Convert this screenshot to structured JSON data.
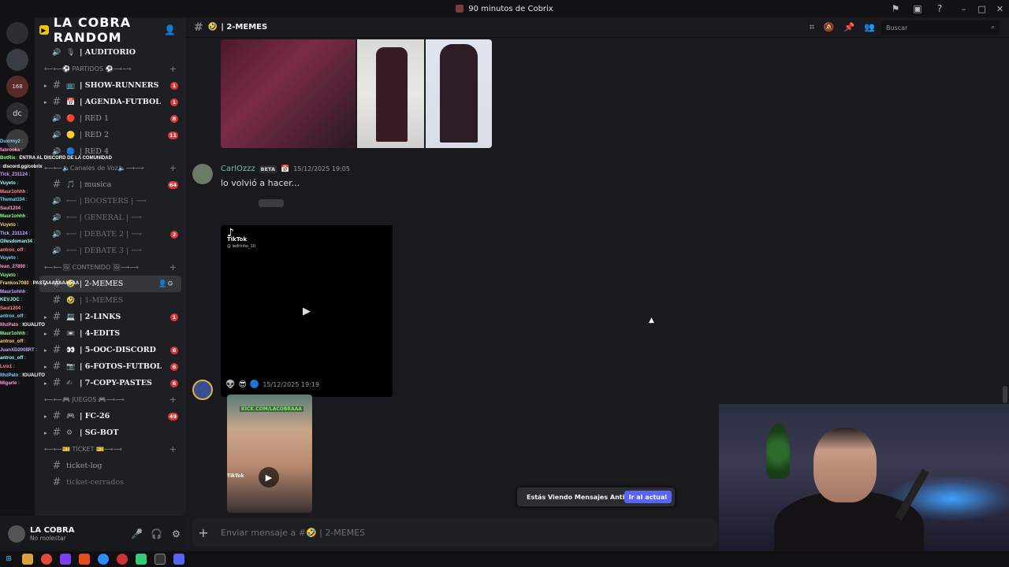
{
  "window": {
    "title": "90 minutos de Cobrix"
  },
  "server": {
    "name": "LA COBRA RANDOM"
  },
  "rail": {
    "items": [
      "",
      "168",
      "dc",
      "",
      "",
      ""
    ]
  },
  "chat_overlay": [
    {
      "u": "Duxrmy2",
      "t": ""
    },
    {
      "u": "fabrooks",
      "t": ""
    },
    {
      "u": "BotRix",
      "t": "ENTRA AL DISCORD DE LA COMUNIDAD"
    },
    {
      "u": "",
      "t": "discord.gg/cobrix"
    },
    {
      "u": "Tick_231124",
      "t": ""
    },
    {
      "u": "Vuyeto",
      "t": ""
    },
    {
      "u": "Maur1ohhh",
      "t": ""
    },
    {
      "u": "Themat104",
      "t": ""
    },
    {
      "u": "Saul1204",
      "t": ""
    },
    {
      "u": "Maur1ohhh",
      "t": ""
    },
    {
      "u": "Vuyeto",
      "t": ""
    },
    {
      "u": "Tick_231124",
      "t": ""
    },
    {
      "u": "Ollesdoman34",
      "t": ""
    },
    {
      "u": "antrox_off",
      "t": ""
    },
    {
      "u": "Vuyeto",
      "t": ""
    },
    {
      "u": "lean_27890",
      "t": ""
    },
    {
      "u": "Vuyeto",
      "t": ""
    },
    {
      "u": "Frankos7080",
      "t": "PASTAAAAAAAAAA"
    },
    {
      "u": "Maur1ohhh",
      "t": ""
    },
    {
      "u": "KEVJOC",
      "t": ""
    },
    {
      "u": "Saul1204",
      "t": ""
    },
    {
      "u": "antrox_off",
      "t": ""
    },
    {
      "u": "IthzPato",
      "t": "IGUALITO"
    },
    {
      "u": "Maur1ohhh",
      "t": ""
    },
    {
      "u": "antrox_off",
      "t": ""
    },
    {
      "u": "JuanXD2008RT",
      "t": ""
    },
    {
      "u": "antrox_off",
      "t": ""
    },
    {
      "u": "Lvix1",
      "t": ""
    },
    {
      "u": "IthzPato",
      "t": "IGUALITO"
    },
    {
      "u": "Migarte",
      "t": ""
    }
  ],
  "channels": [
    {
      "type": "ch",
      "icon": "speaker",
      "emo": "🎙",
      "label": "| AUDITORIO",
      "style": "bold-voice"
    },
    {
      "type": "cat",
      "label": "⟵⟵⚽ PARTIDOS ⚽⟶⟶"
    },
    {
      "type": "ch",
      "emo": "📺",
      "label": "| SHOW-RUNNERS",
      "style": "bold",
      "badge": "1"
    },
    {
      "type": "ch",
      "emo": "📅",
      "label": "| AGENDA-FUTBOL",
      "style": "bold",
      "badge": "1"
    },
    {
      "type": "ch",
      "icon": "speaker",
      "emo": "🔴",
      "label": "| RED 1",
      "style": "",
      "badge": "8"
    },
    {
      "type": "ch",
      "icon": "speaker",
      "emo": "🟡",
      "label": "| RED 2",
      "style": "",
      "badge": "11"
    },
    {
      "type": "ch",
      "icon": "speaker",
      "emo": "🔵",
      "label": "| RED 4",
      "style": ""
    },
    {
      "type": "cat",
      "label": "⟵⟵🔈Canales de Voz🔈⟶⟶"
    },
    {
      "type": "ch",
      "emo": "🎵",
      "label": "| musica",
      "style": "plain",
      "badge": "64"
    },
    {
      "type": "ch",
      "icon": "speaker",
      "emo": "",
      "label": "⟵ | BOOSTERS | ⟶",
      "style": "dim"
    },
    {
      "type": "ch",
      "icon": "speaker",
      "emo": "",
      "label": "⟵ | GENERAL | ⟶",
      "style": "dim"
    },
    {
      "type": "ch",
      "icon": "speaker",
      "emo": "",
      "label": "⟵ | DEBATE 2 | ⟶",
      "style": "dim",
      "badge": "2"
    },
    {
      "type": "ch",
      "icon": "speaker",
      "emo": "",
      "label": "⟵ | DEBATE 3 | ⟶",
      "style": "dim"
    },
    {
      "type": "cat",
      "label": "⟵⟵🖼 CONTENIDO 🖼⟶⟶"
    },
    {
      "type": "ch",
      "emo": "🤣",
      "label": "| 2-MEMES",
      "style": "active"
    },
    {
      "type": "ch",
      "emo": "🤣",
      "label": "| 1-MEMES",
      "style": "dim"
    },
    {
      "type": "ch",
      "emo": "💻",
      "label": "| 2-LINKS",
      "style": "bold",
      "badge": "1"
    },
    {
      "type": "ch",
      "emo": "📼",
      "label": "| 4-EDITS",
      "style": "bold"
    },
    {
      "type": "ch",
      "emo": "👀",
      "label": "| 5-OOC-DISCORD",
      "style": "bold",
      "badge": "6"
    },
    {
      "type": "ch",
      "emo": "📷",
      "label": "| 6-FOTOS-FUTBOL",
      "style": "bold",
      "badge": "6"
    },
    {
      "type": "ch",
      "emo": "✍",
      "label": "| 7-COPY-PASTES",
      "style": "bold",
      "badge": "6"
    },
    {
      "type": "cat",
      "label": "⟵⟵🎮 JUEGOS 🎮⟶⟶"
    },
    {
      "type": "ch",
      "emo": "🎮",
      "label": "| FC-26",
      "style": "bold",
      "badge": "49"
    },
    {
      "type": "ch",
      "emo": "⚙",
      "label": "| SG-BOT",
      "style": "bold"
    },
    {
      "type": "cat",
      "label": "⟵⟵🎫 TICKET 🎫⟶⟶"
    },
    {
      "type": "ch",
      "emo": "",
      "label": "ticket-log",
      "style": "plain"
    },
    {
      "type": "ch",
      "emo": "",
      "label": "ticket-cerrados",
      "style": "dim"
    }
  ],
  "user": {
    "name": "LA COBRA",
    "status": "No molestar"
  },
  "header": {
    "channel": "| 2-MEMES",
    "search_placeholder": "Buscar"
  },
  "messages": [
    {
      "author": "CarlOzzz",
      "badge": "BETA",
      "timestamp": "15/12/2025 19:05",
      "text": "lo volvió a hacer..."
    },
    {
      "author": "",
      "timestamp": "15/12/2025 19:19",
      "text": ""
    }
  ],
  "tiktok": {
    "brand": "TikTok",
    "handle": "@ ledrinho_10"
  },
  "thumb": {
    "overlay": "KICK.COM/LACOBRAAA",
    "brand": "TikTok"
  },
  "notice": {
    "text": "Estás Viendo Mensajes Antiguos",
    "button": "Ir al actual"
  },
  "composer": {
    "placeholder": "Enviar mensaje a #🤣 | 2-MEMES"
  }
}
